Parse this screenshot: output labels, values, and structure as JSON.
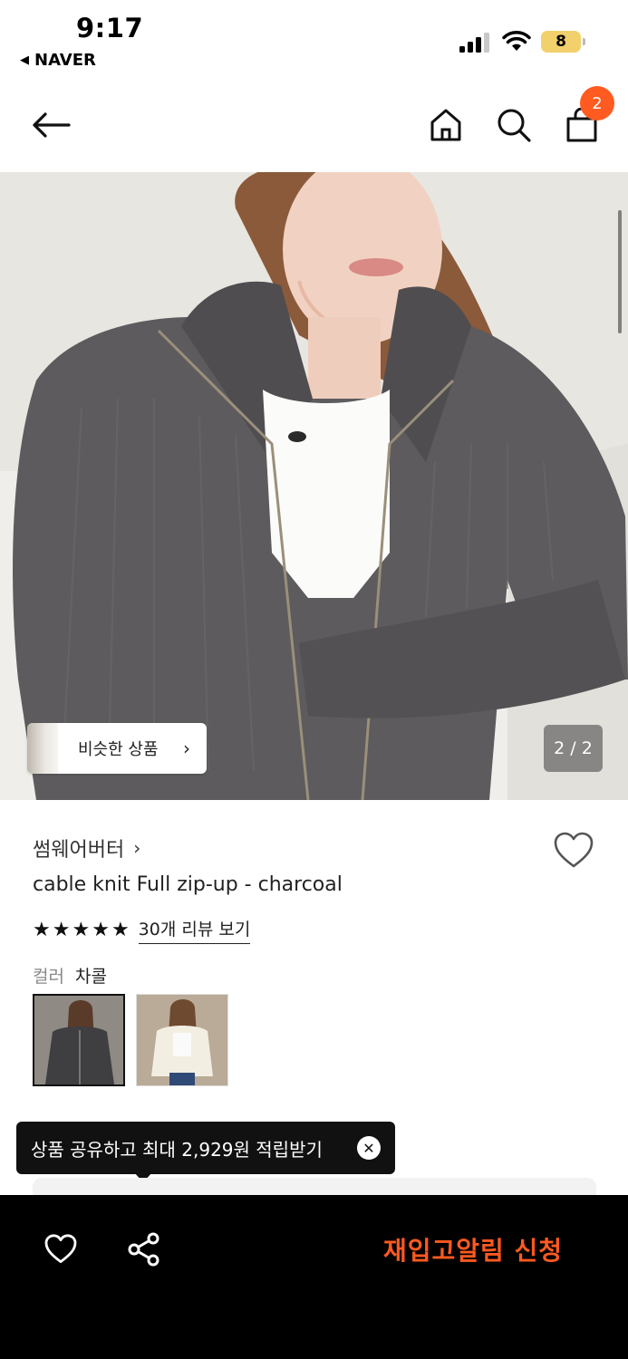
{
  "status_bar": {
    "time": "9:17",
    "back_app": "NAVER",
    "battery": "8"
  },
  "header": {
    "icons": [
      "back-arrow-icon",
      "home-icon",
      "search-icon",
      "cart-icon"
    ],
    "cart_count": "2"
  },
  "gallery": {
    "similar_label": "비슷한 상품",
    "counter": "2 / 2"
  },
  "product": {
    "brand": "썸웨어버터",
    "title": "cable knit Full zip-up - charcoal",
    "rating_stars": 5,
    "review_link": "30개 리뷰 보기",
    "color_label": "컬러",
    "color_value": "차콜",
    "swatches": [
      "charcoal",
      "ivory"
    ]
  },
  "tooltip": {
    "text": "상품 공유하고 최대 2,929원 적립받기"
  },
  "bottom_bar": {
    "restock_label": "재입고알림 신청"
  },
  "colors": {
    "accent": "#ff5a1f",
    "bottom_bar_bg": "#000000"
  }
}
